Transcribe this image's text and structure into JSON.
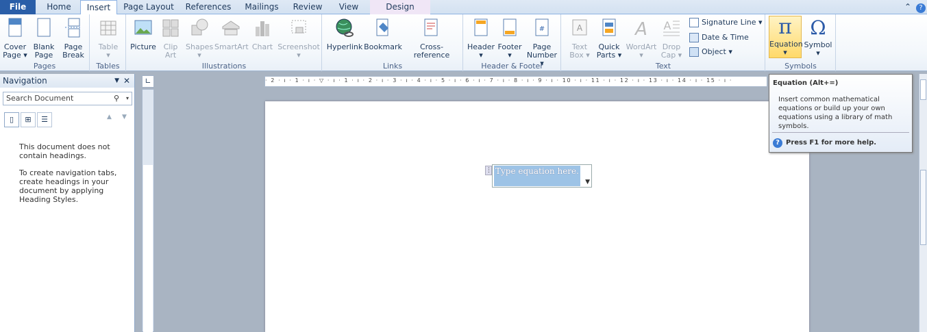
{
  "tabs": [
    "File",
    "Home",
    "Insert",
    "Page Layout",
    "References",
    "Mailings",
    "Review",
    "View",
    "Design"
  ],
  "groups": {
    "pages": {
      "label": "Pages",
      "buttons": [
        {
          "l1": "Cover",
          "l2": "Page ▾"
        },
        {
          "l1": "Blank",
          "l2": "Page"
        },
        {
          "l1": "Page",
          "l2": "Break"
        }
      ]
    },
    "tables": {
      "label": "Tables",
      "buttons": [
        {
          "l1": "Table",
          "l2": "▾"
        }
      ]
    },
    "illustrations": {
      "label": "Illustrations",
      "buttons": [
        {
          "l1": "Picture",
          "l2": ""
        },
        {
          "l1": "Clip",
          "l2": "Art"
        },
        {
          "l1": "Shapes",
          "l2": "▾"
        },
        {
          "l1": "SmartArt",
          "l2": ""
        },
        {
          "l1": "Chart",
          "l2": ""
        },
        {
          "l1": "Screenshot",
          "l2": "▾"
        }
      ]
    },
    "links": {
      "label": "Links",
      "buttons": [
        {
          "l1": "Hyperlink",
          "l2": ""
        },
        {
          "l1": "Bookmark",
          "l2": ""
        },
        {
          "l1": "Cross-reference",
          "l2": ""
        }
      ]
    },
    "header_footer": {
      "label": "Header & Footer",
      "buttons": [
        {
          "l1": "Header",
          "l2": "▾"
        },
        {
          "l1": "Footer",
          "l2": "▾"
        },
        {
          "l1": "Page",
          "l2": "Number ▾"
        }
      ]
    },
    "text": {
      "label": "Text",
      "buttons": [
        {
          "l1": "Text",
          "l2": "Box ▾"
        },
        {
          "l1": "Quick",
          "l2": "Parts ▾"
        },
        {
          "l1": "WordArt",
          "l2": "▾"
        },
        {
          "l1": "Drop",
          "l2": "Cap ▾"
        }
      ],
      "small": [
        "Signature Line ▾",
        "Date & Time",
        "Object ▾"
      ]
    },
    "symbols": {
      "label": "Symbols",
      "buttons": [
        {
          "l1": "Equation",
          "l2": "▾"
        },
        {
          "l1": "Symbol",
          "l2": "▾"
        }
      ]
    }
  },
  "nav": {
    "title": "Navigation",
    "search_placeholder": "Search Document",
    "msg1": "This document does not contain headings.",
    "msg2": "To create navigation tabs, create headings in your document by applying Heading Styles."
  },
  "ruler_labels": "· 2 · ı · 1 · ı · ▽ · ı · 1 · ı · 2 · ı · 3 · ı · 4 · ı · 5 · ı · 6 · ı · 7 · ı · 8 · ı · 9 · ı · 10 · ı · 11 · ı · 12 · ı · 13 · ı · 14 · ı · 15 · ı ·",
  "equation_placeholder": "Type equation here.",
  "tooltip": {
    "title": "Equation (Alt+=)",
    "body": "Insert common mathematical equations or build up your own equations using a library of math symbols.",
    "help": "Press F1 for more help."
  },
  "colors": {
    "file_tab": "#2a5ea8",
    "accent": "#3a7bd5",
    "equation_highlight": "#9dc3e6"
  }
}
